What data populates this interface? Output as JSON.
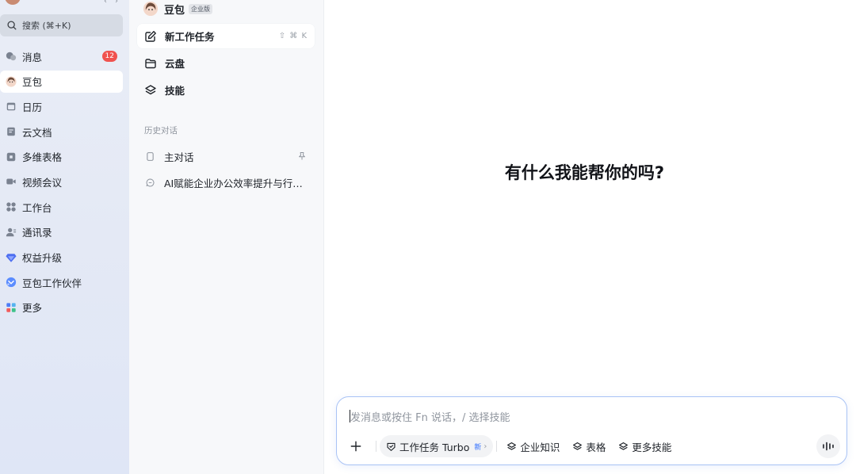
{
  "sidebar": {
    "search": {
      "label": "搜索 (⌘+K)"
    },
    "items": [
      {
        "label": "消息",
        "badge": "12",
        "icon": "message-icon"
      },
      {
        "label": "豆包",
        "icon": "doubao-avatar-icon",
        "active": true
      },
      {
        "label": "日历",
        "icon": "calendar-icon"
      },
      {
        "label": "云文档",
        "icon": "cloud-doc-icon"
      },
      {
        "label": "多维表格",
        "icon": "base-table-icon"
      },
      {
        "label": "视频会议",
        "icon": "video-meeting-icon"
      },
      {
        "label": "工作台",
        "icon": "workplace-icon"
      },
      {
        "label": "通讯录",
        "icon": "contacts-icon"
      },
      {
        "label": "权益升级",
        "icon": "diamond-icon"
      },
      {
        "label": "豆包工作伙伴",
        "icon": "partner-icon"
      },
      {
        "label": "更多",
        "icon": "more-apps-icon"
      }
    ]
  },
  "mid": {
    "title": "豆包",
    "edition": "企业版",
    "items": [
      {
        "label": "新工作任务",
        "shortcut": "⇧ ⌘ K",
        "icon": "edit-icon"
      },
      {
        "label": "云盘",
        "icon": "folder-icon"
      },
      {
        "label": "技能",
        "icon": "layers-icon"
      }
    ],
    "history_label": "历史对话",
    "history": [
      {
        "label": "主对话",
        "icon": "doc-icon"
      },
      {
        "label": "AI赋能企业办公效率提升与行业...",
        "icon": "chat-icon"
      }
    ]
  },
  "main": {
    "hero": "有什么我能帮你的吗?",
    "composer": {
      "placeholder": "发消息或按住 Fn 说话，/ 选择技能",
      "chips": {
        "task": "工作任务 Turbo",
        "task_new": "新",
        "knowledge": "企业知识",
        "sheet": "表格",
        "more_skills": "更多技能"
      }
    }
  },
  "colors": {
    "accent": "#3370ff",
    "badge": "#f0524f",
    "composer_border": "#a9c3f5"
  }
}
